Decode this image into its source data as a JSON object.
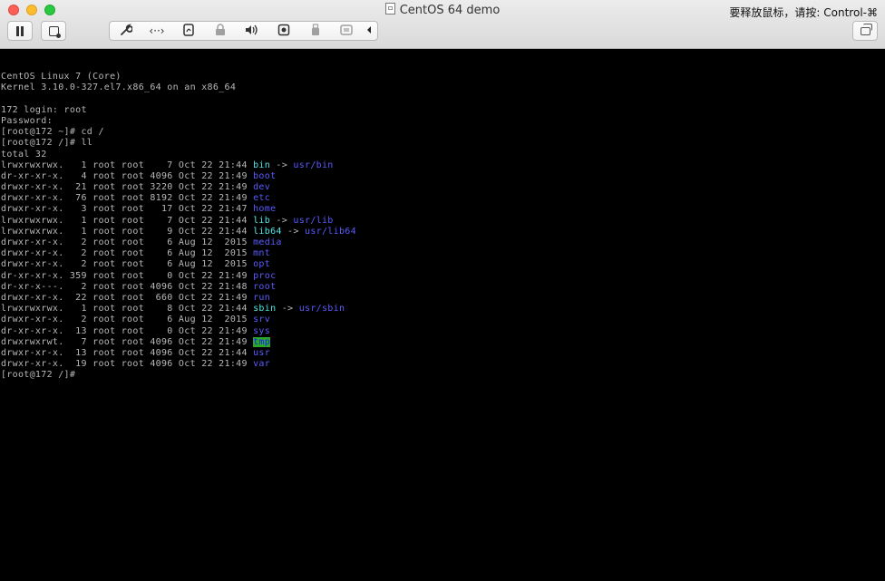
{
  "window": {
    "title": "CentOS 64 demo",
    "release_hint": "要释放鼠标，请按: Control-⌘"
  },
  "toolbar": {
    "left_buttons": [
      "pause-icon",
      "snapshot-icon"
    ],
    "group_icons": [
      "wrench-icon",
      "network-icon",
      "shared-folders-icon",
      "lock-icon",
      "sound-icon",
      "camera-icon",
      "usb-icon",
      "sync-icon",
      "collapse-arrow-icon"
    ],
    "right_buttons": [
      "restore-window-icon"
    ]
  },
  "terminal": {
    "lines": [
      {
        "segments": [
          {
            "t": ""
          }
        ]
      },
      {
        "segments": [
          {
            "t": "CentOS Linux 7 (Core)"
          }
        ]
      },
      {
        "segments": [
          {
            "t": "Kernel 3.10.0-327.el7.x86_64 on an x86_64"
          }
        ]
      },
      {
        "segments": [
          {
            "t": ""
          }
        ]
      },
      {
        "segments": [
          {
            "t": "172 login: root"
          }
        ]
      },
      {
        "segments": [
          {
            "t": "Password:"
          }
        ]
      },
      {
        "segments": [
          {
            "t": "[root@172 ~]# cd /"
          }
        ]
      },
      {
        "segments": [
          {
            "t": "[root@172 /]# ll"
          }
        ]
      },
      {
        "segments": [
          {
            "t": "total 32"
          }
        ]
      },
      {
        "segments": [
          {
            "t": "lrwxrwxrwx.   1 root root    7 Oct 22 21:44 "
          },
          {
            "t": "bin",
            "c": "lnk"
          },
          {
            "t": " -> "
          },
          {
            "t": "usr/bin",
            "c": "dir"
          }
        ]
      },
      {
        "segments": [
          {
            "t": "dr-xr-xr-x.   4 root root 4096 Oct 22 21:49 "
          },
          {
            "t": "boot",
            "c": "dir"
          }
        ]
      },
      {
        "segments": [
          {
            "t": "drwxr-xr-x.  21 root root 3220 Oct 22 21:49 "
          },
          {
            "t": "dev",
            "c": "dir"
          }
        ]
      },
      {
        "segments": [
          {
            "t": "drwxr-xr-x.  76 root root 8192 Oct 22 21:49 "
          },
          {
            "t": "etc",
            "c": "dir"
          }
        ]
      },
      {
        "segments": [
          {
            "t": "drwxr-xr-x.   3 root root   17 Oct 22 21:47 "
          },
          {
            "t": "home",
            "c": "dir"
          }
        ]
      },
      {
        "segments": [
          {
            "t": "lrwxrwxrwx.   1 root root    7 Oct 22 21:44 "
          },
          {
            "t": "lib",
            "c": "lnk"
          },
          {
            "t": " -> "
          },
          {
            "t": "usr/lib",
            "c": "dir"
          }
        ]
      },
      {
        "segments": [
          {
            "t": "lrwxrwxrwx.   1 root root    9 Oct 22 21:44 "
          },
          {
            "t": "lib64",
            "c": "lnk"
          },
          {
            "t": " -> "
          },
          {
            "t": "usr/lib64",
            "c": "dir"
          }
        ]
      },
      {
        "segments": [
          {
            "t": "drwxr-xr-x.   2 root root    6 Aug 12  2015 "
          },
          {
            "t": "media",
            "c": "dir"
          }
        ]
      },
      {
        "segments": [
          {
            "t": "drwxr-xr-x.   2 root root    6 Aug 12  2015 "
          },
          {
            "t": "mnt",
            "c": "dir"
          }
        ]
      },
      {
        "segments": [
          {
            "t": "drwxr-xr-x.   2 root root    6 Aug 12  2015 "
          },
          {
            "t": "opt",
            "c": "dir"
          }
        ]
      },
      {
        "segments": [
          {
            "t": "dr-xr-xr-x. 359 root root    0 Oct 22 21:49 "
          },
          {
            "t": "proc",
            "c": "dir"
          }
        ]
      },
      {
        "segments": [
          {
            "t": "dr-xr-x---.   2 root root 4096 Oct 22 21:48 "
          },
          {
            "t": "root",
            "c": "dir"
          }
        ]
      },
      {
        "segments": [
          {
            "t": "drwxr-xr-x.  22 root root  660 Oct 22 21:49 "
          },
          {
            "t": "run",
            "c": "dir"
          }
        ]
      },
      {
        "segments": [
          {
            "t": "lrwxrwxrwx.   1 root root    8 Oct 22 21:44 "
          },
          {
            "t": "sbin",
            "c": "lnk"
          },
          {
            "t": " -> "
          },
          {
            "t": "usr/sbin",
            "c": "dir"
          }
        ]
      },
      {
        "segments": [
          {
            "t": "drwxr-xr-x.   2 root root    6 Aug 12  2015 "
          },
          {
            "t": "srv",
            "c": "dir"
          }
        ]
      },
      {
        "segments": [
          {
            "t": "dr-xr-xr-x.  13 root root    0 Oct 22 21:49 "
          },
          {
            "t": "sys",
            "c": "dir"
          }
        ]
      },
      {
        "segments": [
          {
            "t": "drwxrwxrwt.   7 root root 4096 Oct 22 21:49 "
          },
          {
            "t": "tmp",
            "c": "sticky"
          }
        ]
      },
      {
        "segments": [
          {
            "t": "drwxr-xr-x.  13 root root 4096 Oct 22 21:44 "
          },
          {
            "t": "usr",
            "c": "dir"
          }
        ]
      },
      {
        "segments": [
          {
            "t": "drwxr-xr-x.  19 root root 4096 Oct 22 21:49 "
          },
          {
            "t": "var",
            "c": "dir"
          }
        ]
      },
      {
        "segments": [
          {
            "t": "[root@172 /]# "
          }
        ]
      }
    ]
  }
}
